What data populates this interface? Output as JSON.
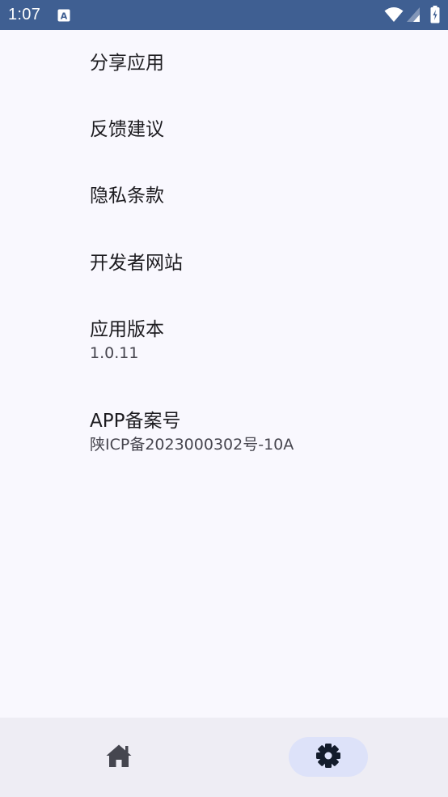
{
  "status_bar": {
    "time": "1:07",
    "icons": [
      "text-a-icon",
      "wifi-icon",
      "signal-icon",
      "battery-icon"
    ]
  },
  "settings": {
    "items": [
      {
        "title": "分享应用"
      },
      {
        "title": "反馈建议"
      },
      {
        "title": "隐私条款"
      },
      {
        "title": "开发者网站"
      },
      {
        "title": "应用版本",
        "subtitle": "1.0.11"
      },
      {
        "title": "APP备案号",
        "subtitle": "陕ICP备2023000302号-10A"
      }
    ]
  },
  "bottom_nav": {
    "items": [
      {
        "icon": "home-icon",
        "selected": false
      },
      {
        "icon": "gear-icon",
        "selected": true
      }
    ]
  },
  "colors": {
    "status_bar": "#3f5f92",
    "background": "#f9f8fe",
    "nav_background": "#eeedf4",
    "nav_selected_pill": "#dde2f9",
    "text_primary": "#1c1b1f",
    "text_secondary": "#47464f"
  }
}
